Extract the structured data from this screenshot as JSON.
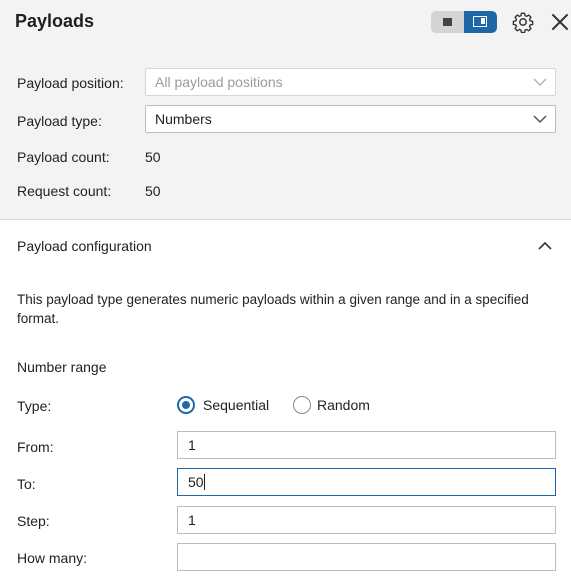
{
  "header": {
    "title": "Payloads",
    "icons": [
      "layout-toggle-left-icon",
      "layout-toggle-right-icon",
      "gear-icon",
      "close-icon"
    ]
  },
  "settings": {
    "position_label": "Payload position:",
    "position_placeholder": "All payload positions",
    "type_label": "Payload type:",
    "type_value": "Numbers",
    "count_label": "Payload count:",
    "count_value": "50",
    "request_label": "Request count:",
    "request_value": "50"
  },
  "config": {
    "title": "Payload configuration",
    "description": "This payload type generates numeric payloads within a given range and in a specified format.",
    "range_title": "Number range",
    "type_label": "Type:",
    "sequential_label": "Sequential",
    "random_label": "Random",
    "selected_type": "Sequential",
    "from_label": "From:",
    "from_value": "1",
    "to_label": "To:",
    "to_value": "50",
    "step_label": "Step:",
    "step_value": "1",
    "how_many_label": "How many:",
    "how_many_value": ""
  },
  "colors": {
    "accent": "#1f67a8",
    "panel_bg": "#f3f3f3"
  }
}
